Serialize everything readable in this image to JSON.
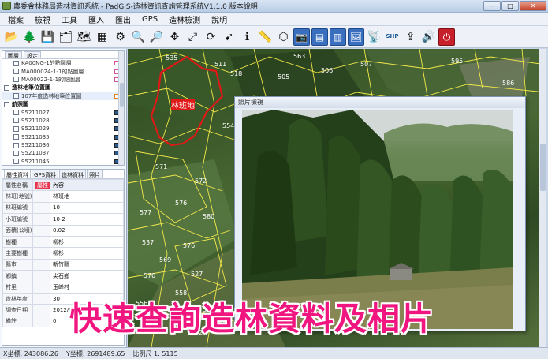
{
  "window": {
    "title": "農委會林務局造林資訊系統 - PadGIS-造林資訊查詢管理系統V1.1.0 版本說明",
    "controls": {
      "minimize": "–",
      "maximize": "□",
      "close": "✕"
    }
  },
  "menu": [
    "檔案",
    "檢視",
    "工具",
    "匯入",
    "匯出",
    "GPS",
    "造林檢測",
    "說明"
  ],
  "toolbar": [
    {
      "icon": "folder-icon",
      "glyph": "📂"
    },
    {
      "icon": "tree-icon",
      "glyph": "🌲"
    },
    {
      "icon": "save-icon",
      "glyph": "💾"
    },
    {
      "icon": "layers-icon",
      "glyph": "🗂"
    },
    {
      "icon": "map-icon",
      "glyph": "🗺"
    },
    {
      "icon": "grid-icon",
      "glyph": "▦"
    },
    {
      "icon": "gear-icon",
      "glyph": "⚙"
    },
    {
      "icon": "zoom-in-icon",
      "glyph": "🔍"
    },
    {
      "icon": "zoom-out-icon",
      "glyph": "🔎"
    },
    {
      "icon": "pan-icon",
      "glyph": "✥"
    },
    {
      "icon": "full-extent-icon",
      "glyph": "⤢"
    },
    {
      "icon": "refresh-icon",
      "glyph": "⟳"
    },
    {
      "icon": "pointer-icon",
      "glyph": "➹"
    },
    {
      "icon": "identify-icon",
      "glyph": "ℹ"
    },
    {
      "icon": "measure-icon",
      "glyph": "📏"
    },
    {
      "icon": "polygon-icon",
      "glyph": "⬡"
    },
    {
      "icon": "photo-icon",
      "glyph": "📷"
    },
    {
      "icon": "table-icon",
      "glyph": "▤"
    },
    {
      "icon": "chart-icon",
      "glyph": "▥"
    },
    {
      "icon": "camera-icon",
      "glyph": "🖼"
    },
    {
      "icon": "gps-icon",
      "glyph": "📡"
    },
    {
      "icon": "shp-icon",
      "glyph": "SHP"
    },
    {
      "icon": "export-icon",
      "glyph": "⇪"
    },
    {
      "icon": "speaker-icon",
      "glyph": "🔊"
    },
    {
      "icon": "power-icon",
      "glyph": "⏻"
    }
  ],
  "layer_tree": {
    "tabs": [
      "圖層",
      "設定"
    ],
    "rows": [
      {
        "type": "child",
        "label": "KA00NG-1的點圖層",
        "swatch": "pink"
      },
      {
        "type": "child",
        "label": "MA000024-1-1的點圖層",
        "swatch": "pink"
      },
      {
        "type": "child",
        "label": "MA00022-1-1的點圖層",
        "swatch": "pink"
      },
      {
        "type": "group",
        "label": "造林地筆位置圖",
        "swatch": ""
      },
      {
        "type": "child",
        "label": "107年度造林地筆位置圖",
        "swatch": "orange"
      },
      {
        "type": "group",
        "label": "航照圖",
        "swatch": ""
      },
      {
        "type": "child",
        "label": "95211027",
        "swatch": "dark"
      },
      {
        "type": "child",
        "label": "95211028",
        "swatch": "dark"
      },
      {
        "type": "child",
        "label": "95211029",
        "swatch": "dark"
      },
      {
        "type": "child",
        "label": "95211035",
        "swatch": "dark"
      },
      {
        "type": "child",
        "label": "95211036",
        "swatch": "dark"
      },
      {
        "type": "child",
        "label": "95211037",
        "swatch": "dark"
      },
      {
        "type": "child",
        "label": "95211045",
        "swatch": "dark"
      }
    ]
  },
  "attributes": {
    "tabs": [
      "屬性資料",
      "GPS資料",
      "造林資料",
      "照片"
    ],
    "header": {
      "key": "屬性名稱",
      "marker": "屬性",
      "value": "內容"
    },
    "rows": [
      {
        "key": "林班(地號)",
        "value": "林班地"
      },
      {
        "key": "林班編號",
        "value": "10"
      },
      {
        "key": "小班編號",
        "value": "10-2"
      },
      {
        "key": "面積(公頃)",
        "value": "0.02"
      },
      {
        "key": "樹種",
        "value": "柳杉"
      },
      {
        "key": "主要樹種",
        "value": "柳杉"
      },
      {
        "key": "縣市",
        "value": "新竹縣"
      },
      {
        "key": "鄉鎮",
        "value": "尖石鄉"
      },
      {
        "key": "村里",
        "value": "玉峰村"
      },
      {
        "key": "造林年度",
        "value": "30"
      },
      {
        "key": "調查日期",
        "value": "2012/05/08"
      },
      {
        "key": "備註",
        "value": "0"
      }
    ]
  },
  "map": {
    "parcel_label": "林班地",
    "parcel_numbers": [
      "535",
      "511",
      "518",
      "505",
      "506",
      "507",
      "563",
      "595",
      "586",
      "554",
      "571",
      "572",
      "576",
      "577",
      "580",
      "537",
      "576",
      "569",
      "570",
      "527",
      "558",
      "556",
      "549",
      "546",
      "492",
      "505"
    ]
  },
  "photo_window": {
    "title": "照片檢視"
  },
  "caption": "快速查詢造林資料及相片",
  "status": {
    "x": "X坐標: 243086.26",
    "y": "Y坐標: 2691489.65",
    "scale": "比例尺 1: 5115"
  },
  "colors": {
    "caption": "#f0157f",
    "parcel_boundary": "#f2e84a",
    "selected_parcel": "#e01818",
    "parcel_numbers": "#ffffff"
  }
}
